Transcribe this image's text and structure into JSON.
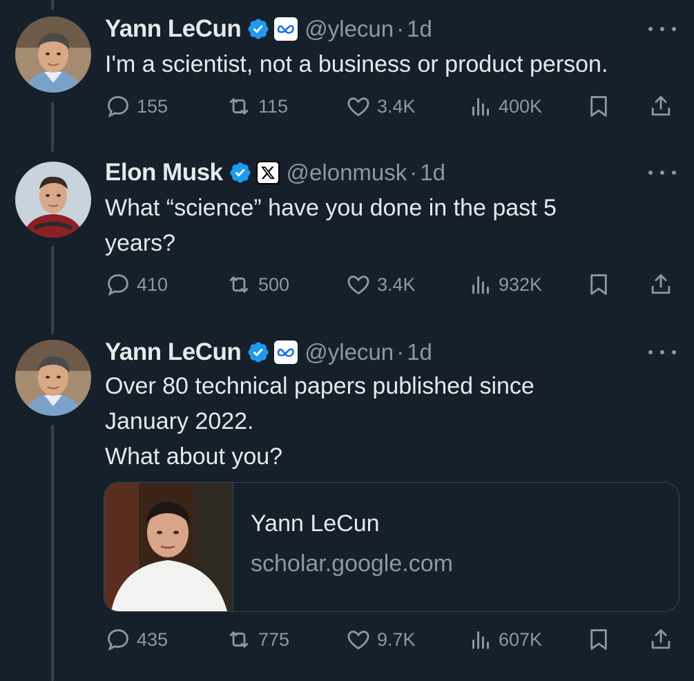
{
  "colors": {
    "background": "#15202b",
    "text_primary": "#e7e9ea",
    "text_secondary": "#8b98a5",
    "verified_blue": "#1d9bf0",
    "border": "#38444d"
  },
  "tweets": [
    {
      "author": {
        "name": "Yann LeCun",
        "verified": true,
        "affiliation_icon": "meta-logo-icon",
        "handle": "@ylecun"
      },
      "separator": "·",
      "time": "1d",
      "text_lines": [
        "I'm a scientist, not a business or product person."
      ],
      "stats": {
        "replies": "155",
        "retweets": "115",
        "likes": "3.4K",
        "views": "400K"
      }
    },
    {
      "author": {
        "name": "Elon Musk",
        "verified": true,
        "affiliation_icon": "x-logo-icon",
        "handle": "@elonmusk"
      },
      "separator": "·",
      "time": "1d",
      "text_lines": [
        "What “science” have you done in the past 5",
        "years?"
      ],
      "stats": {
        "replies": "410",
        "retweets": "500",
        "likes": "3.4K",
        "views": "932K"
      }
    },
    {
      "author": {
        "name": "Yann LeCun",
        "verified": true,
        "affiliation_icon": "meta-logo-icon",
        "handle": "@ylecun"
      },
      "separator": "·",
      "time": "1d",
      "text_lines": [
        "Over 80 technical papers published since",
        "January 2022.",
        "What about you?"
      ],
      "link_card": {
        "title": "Yann LeCun",
        "domain": "scholar.google.com"
      },
      "stats": {
        "replies": "435",
        "retweets": "775",
        "likes": "9.7K",
        "views": "607K"
      }
    }
  ]
}
